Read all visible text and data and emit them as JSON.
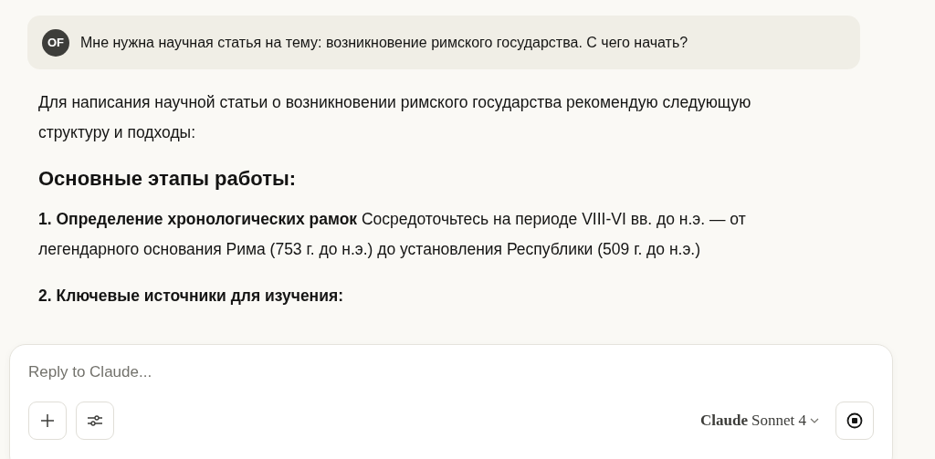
{
  "user_message": {
    "avatar_initials": "OF",
    "text": "Мне нужна научная статья на тему: возникновение римского государства. С чего начать?"
  },
  "response": {
    "blocks": [
      {
        "kind": "paragraph",
        "text": "Для написания научной статьи о возникновении римского государства рекомендую следующую структуру и подходы:"
      },
      {
        "kind": "heading",
        "text": "Основные этапы работы:"
      },
      {
        "kind": "paragraph",
        "text": "**1. Определение хронологических рамок** Сосредоточьтесь на периоде VIII-VI вв. до н.э. — от легендарного основания Рима (753 г. до н.э.) до установления Республики (509 г. до н.э.)"
      },
      {
        "kind": "subheading",
        "text": "2. Ключевые источники для изучения:"
      }
    ]
  },
  "composer": {
    "placeholder": "Reply to Claude...",
    "model_name": "Claude",
    "model_version": "Sonnet 4"
  }
}
